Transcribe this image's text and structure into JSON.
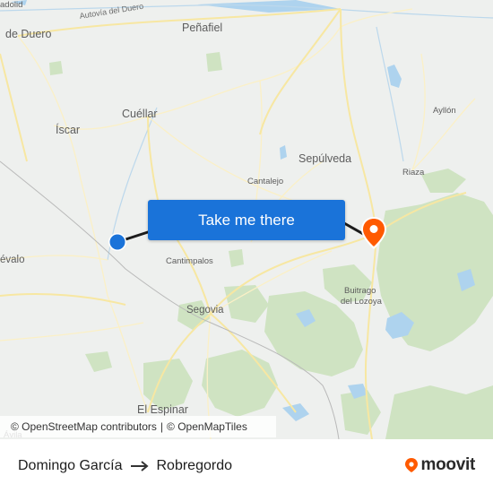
{
  "map": {
    "places": [
      {
        "name": "adolid",
        "size": "small"
      },
      {
        "name": "de Duero",
        "size": "big"
      },
      {
        "name": "Autovía del Duero",
        "size": "road"
      },
      {
        "name": "Peñafiel",
        "size": "big"
      },
      {
        "name": "Cuéllar",
        "size": "big"
      },
      {
        "name": "Íscar",
        "size": "big"
      },
      {
        "name": "Sepúlveda",
        "size": "big"
      },
      {
        "name": "Ayllón",
        "size": "small"
      },
      {
        "name": "Riaza",
        "size": "small"
      },
      {
        "name": "Cantalejo",
        "size": "small"
      },
      {
        "name": "évalo",
        "size": "mid"
      },
      {
        "name": "Cantimpalos",
        "size": "small"
      },
      {
        "name": "Segovia",
        "size": "mid"
      },
      {
        "name": "Buitrago",
        "size": "small"
      },
      {
        "name": "del Lozoya",
        "size": "small"
      },
      {
        "name": "El Espinar",
        "size": "big"
      },
      {
        "name": "Ávila",
        "size": "small"
      }
    ],
    "origin_marker_color": "#1a73d9",
    "destination_marker_color": "#ff5a00"
  },
  "cta": {
    "label": "Take me there"
  },
  "attribution": {
    "osm": "© OpenStreetMap contributors",
    "sep": "|",
    "omt": "© OpenMapTiles"
  },
  "route": {
    "origin": "Domingo García",
    "destination": "Robregordo"
  },
  "brand": {
    "name": "moovit",
    "color": "#ff5a00"
  }
}
